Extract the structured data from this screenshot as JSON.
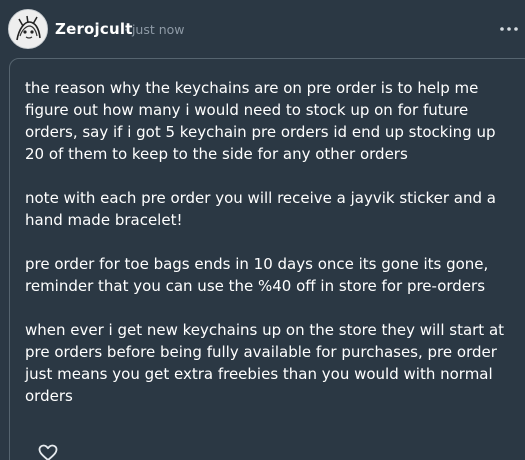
{
  "post": {
    "username": "Zerojcult",
    "timestamp": "· just now",
    "paragraphs": [
      "the reason why the keychains are on pre order is to help me figure out how many i would need to stock up on for future orders, say if i got 5 keychain pre orders id end up stocking up 20 of them to keep to the side for any other orders",
      "note with each pre order you will receive a jayvik sticker and a hand made bracelet!",
      "pre order for toe bags ends in 10 days once its gone its gone, reminder that you can use the %40 off in store for pre-orders",
      "when ever i get new keychains up on the store they will start at pre orders before being fully available for purchases, pre order just means you get extra freebies than you would with normal orders"
    ]
  },
  "icons": {
    "avatar": "avatar-image",
    "more": "more-options-icon",
    "like": "heart-icon"
  },
  "colors": {
    "background": "#2b3844",
    "text": "#ffffff",
    "muted": "#8e9aa6",
    "border": "#56646f"
  }
}
